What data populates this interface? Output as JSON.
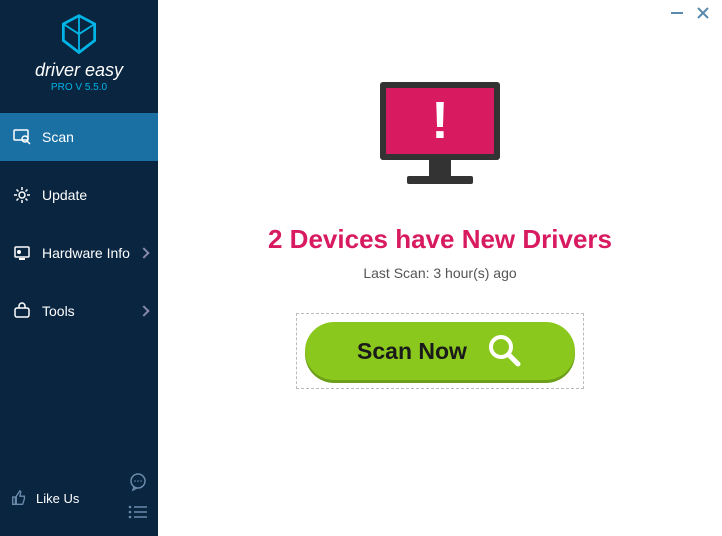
{
  "brand": {
    "name": "driver easy",
    "version": "PRO V 5.5.0"
  },
  "sidebar": {
    "items": [
      {
        "label": "Scan",
        "active": true,
        "chevron": false
      },
      {
        "label": "Update",
        "active": false,
        "chevron": false
      },
      {
        "label": "Hardware Info",
        "active": false,
        "chevron": true
      },
      {
        "label": "Tools",
        "active": false,
        "chevron": true
      }
    ],
    "like_label": "Like Us"
  },
  "main": {
    "headline": "2 Devices have New Drivers",
    "last_scan": "Last Scan: 3 hour(s) ago",
    "scan_button": "Scan Now"
  },
  "colors": {
    "sidebar_bg": "#0a2540",
    "active_bg": "#1a6fa3",
    "accent": "#00b4e6",
    "alert": "#d81b60",
    "scan_green": "#8bc81e"
  }
}
